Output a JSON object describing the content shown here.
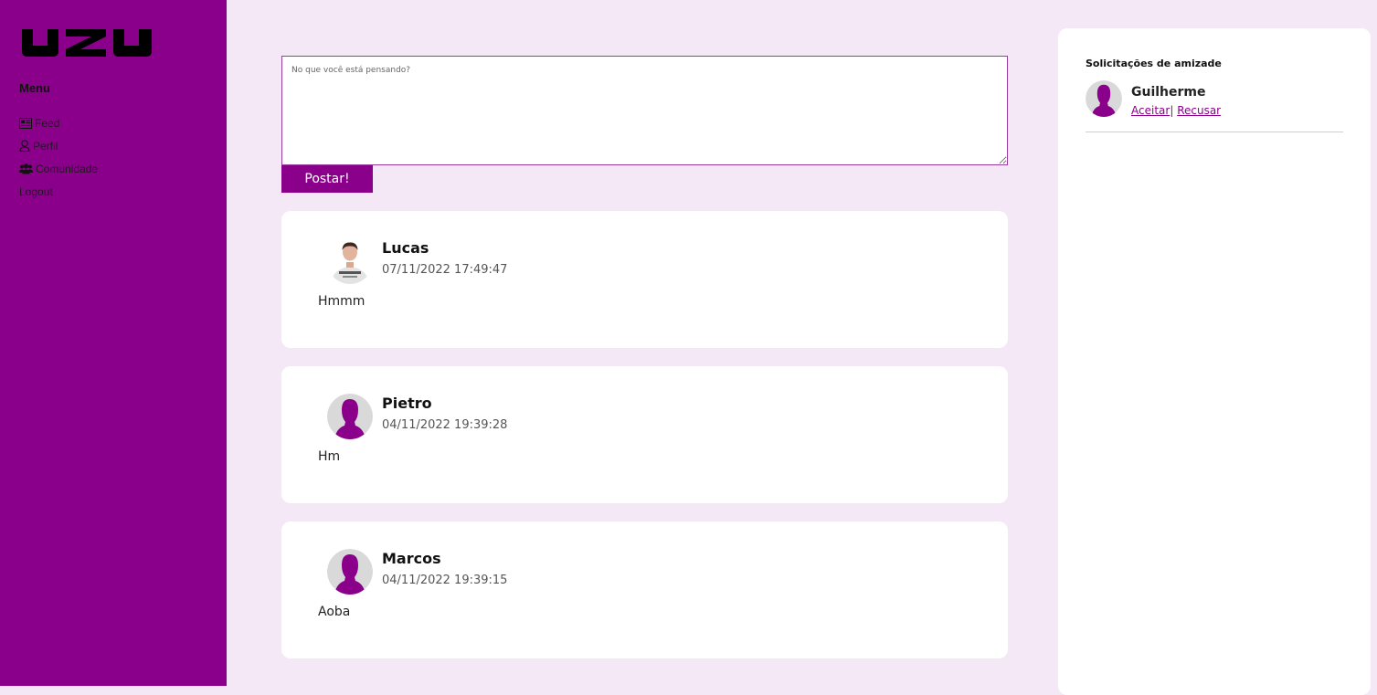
{
  "app": {
    "logo_text": "UZU"
  },
  "sidebar": {
    "menu_title": "Menu",
    "items": [
      {
        "label": "Feed",
        "icon": "newspaper-icon"
      },
      {
        "label": "Perfil",
        "icon": "user-icon"
      },
      {
        "label": "Comunidade",
        "icon": "users-icon"
      },
      {
        "label": "Logout",
        "icon": ""
      }
    ]
  },
  "composer": {
    "placeholder": "No que você está pensando?",
    "value": "",
    "submit_label": "Postar!"
  },
  "posts": [
    {
      "author": "Lucas",
      "timestamp": "07/11/2022 17:49:47",
      "body": "Hmmm",
      "avatar": "photo-avatar"
    },
    {
      "author": "Pietro",
      "timestamp": "04/11/2022 19:39:28",
      "body": "Hm",
      "avatar": "default-avatar"
    },
    {
      "author": "Marcos",
      "timestamp": "04/11/2022 19:39:15",
      "body": "Aoba",
      "avatar": "default-avatar"
    }
  ],
  "friend_requests": {
    "title": "Solicitações de amizade",
    "items": [
      {
        "name": "Guilherme",
        "accept_label": "Aceitar",
        "separator": "|",
        "reject_label": "Recusar"
      }
    ]
  },
  "colors": {
    "brand": "#8b008b",
    "background": "#f5e8f6",
    "card": "#ffffff",
    "avatar_bg": "#d9d9d9"
  }
}
